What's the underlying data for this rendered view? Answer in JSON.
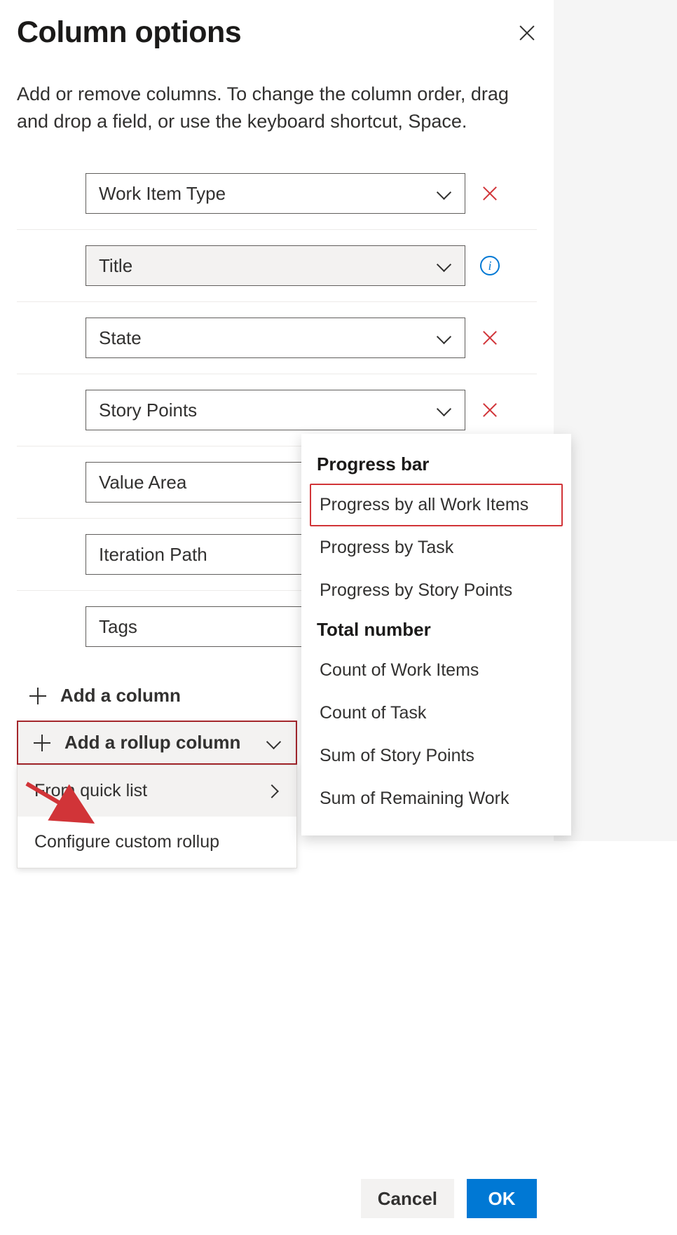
{
  "panel": {
    "title": "Column options",
    "description": "Add or remove columns. To change the column order, drag and drop a field, or use the keyboard shortcut, Space."
  },
  "columns": [
    {
      "label": "Work Item Type",
      "action": "remove"
    },
    {
      "label": "Title",
      "action": "info",
      "disabled": true
    },
    {
      "label": "State",
      "action": "remove"
    },
    {
      "label": "Story Points",
      "action": "remove"
    },
    {
      "label": "Value Area",
      "action": "remove"
    },
    {
      "label": "Iteration Path",
      "action": "remove"
    },
    {
      "label": "Tags",
      "action": "remove"
    }
  ],
  "actions": {
    "addColumn": "Add a column",
    "addRollup": "Add a rollup column"
  },
  "rollupMenu": {
    "items": [
      {
        "label": "From quick list",
        "hasSubmenu": true
      },
      {
        "label": "Configure custom rollup",
        "hasSubmenu": false
      }
    ]
  },
  "quickList": {
    "groups": [
      {
        "header": "Progress bar",
        "items": [
          {
            "label": "Progress by all Work Items",
            "highlight": true
          },
          {
            "label": "Progress by Task"
          },
          {
            "label": "Progress by Story Points"
          }
        ]
      },
      {
        "header": "Total number",
        "items": [
          {
            "label": "Count of Work Items"
          },
          {
            "label": "Count of Task"
          },
          {
            "label": "Sum of Story Points"
          },
          {
            "label": "Sum of Remaining Work"
          }
        ]
      }
    ]
  },
  "footer": {
    "cancel": "Cancel",
    "ok": "OK"
  },
  "info_glyph": "i"
}
